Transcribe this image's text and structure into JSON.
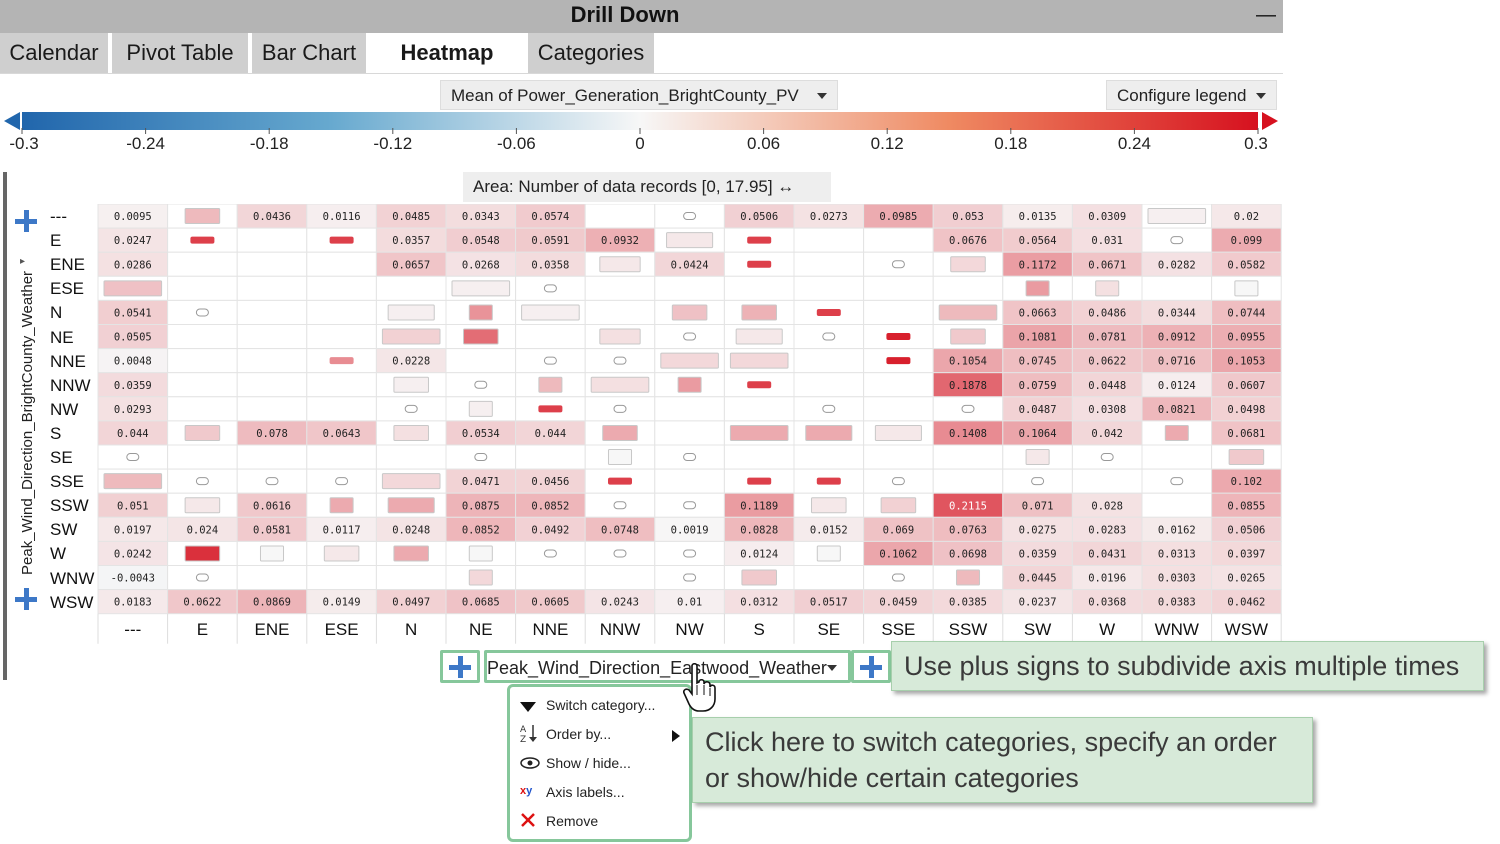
{
  "window": {
    "title": "Drill Down",
    "minimize_glyph": "—"
  },
  "tabs": [
    {
      "label": "Calendar",
      "active": false
    },
    {
      "label": "Pivot Table",
      "active": false
    },
    {
      "label": "Bar Chart",
      "active": false
    },
    {
      "label": "Heatmap",
      "active": true
    },
    {
      "label": "Categories",
      "active": false
    }
  ],
  "toolbar": {
    "measure_dropdown": "Mean of Power_Generation_BrightCounty_PV",
    "configure_legend": "Configure legend"
  },
  "legend": {
    "ticks": [
      "-0.3",
      "-0.24",
      "-0.18",
      "-0.12",
      "-0.06",
      "0",
      "0.06",
      "0.12",
      "0.18",
      "0.24",
      "0.3"
    ],
    "colors": {
      "negative": "#2166ac",
      "neutral": "#f7f7f7",
      "positive": "#d6111f"
    }
  },
  "area": {
    "label": "Area:",
    "value": "Number of data records  [0, 17.95] ↔"
  },
  "y_axis": {
    "title": "Peak_Wind_Direction_BrightCounty_Weather",
    "categories": [
      "---",
      "E",
      "ENE",
      "ESE",
      "N",
      "NE",
      "NNE",
      "NNW",
      "NW",
      "S",
      "SE",
      "SSE",
      "SSW",
      "SW",
      "W",
      "WNW",
      "WSW"
    ]
  },
  "x_axis": {
    "title": "Peak_Wind_Direction_Eastwood_Weather",
    "categories": [
      "---",
      "E",
      "ENE",
      "ESE",
      "N",
      "NE",
      "NNE",
      "NNW",
      "NW",
      "S",
      "SE",
      "SSE",
      "SSW",
      "SW",
      "W",
      "WNW",
      "WSW"
    ]
  },
  "chart_data": {
    "type": "heatmap",
    "color_range": [
      -0.3,
      0.3
    ],
    "rows": [
      {
        "label": "---",
        "values": [
          "0.0095",
          "",
          "0.0436",
          "0.0116",
          "0.0485",
          "0.0343",
          "0.0574",
          "",
          "",
          "0.0506",
          "0.0273",
          "0.0985",
          "0.053",
          "0.0135",
          "0.0309",
          "",
          "0.02"
        ]
      },
      {
        "label": "E",
        "values": [
          "0.0247",
          "",
          "",
          "",
          "0.0357",
          "0.0548",
          "0.0591",
          "0.0932",
          "",
          "",
          "",
          "",
          "0.0676",
          "0.0564",
          "0.031",
          "",
          "0.099"
        ]
      },
      {
        "label": "ENE",
        "values": [
          "0.0286",
          "",
          "",
          "",
          "0.0657",
          "0.0268",
          "0.0358",
          "",
          "0.0424",
          "",
          "",
          "",
          "",
          "0.1172",
          "0.0671",
          "0.0282",
          "0.0582"
        ]
      },
      {
        "label": "ESE",
        "values": [
          "",
          "",
          "",
          "",
          "",
          "",
          "",
          "",
          "",
          "",
          "",
          "",
          "",
          "",
          "",
          "",
          ""
        ]
      },
      {
        "label": "N",
        "values": [
          "0.0541",
          "",
          "",
          "",
          "",
          "",
          "",
          "",
          "",
          "",
          "",
          "",
          "",
          "0.0663",
          "0.0486",
          "0.0344",
          "0.0744"
        ]
      },
      {
        "label": "NE",
        "values": [
          "0.0505",
          "",
          "",
          "",
          "",
          "",
          "",
          "",
          "",
          "",
          "",
          "",
          "",
          "0.1081",
          "0.0781",
          "0.0912",
          "0.0955"
        ]
      },
      {
        "label": "NNE",
        "values": [
          "0.0048",
          "",
          "",
          "",
          "0.0228",
          "",
          "",
          "",
          "",
          "",
          "",
          "",
          "0.1054",
          "0.0745",
          "0.0622",
          "0.0716",
          "0.1053"
        ]
      },
      {
        "label": "NNW",
        "values": [
          "0.0359",
          "",
          "",
          "",
          "",
          "",
          "",
          "",
          "",
          "",
          "",
          "",
          "0.1878",
          "0.0759",
          "0.0448",
          "0.0124",
          "0.0607"
        ]
      },
      {
        "label": "NW",
        "values": [
          "0.0293",
          "",
          "",
          "",
          "",
          "",
          "",
          "",
          "",
          "",
          "",
          "",
          "",
          "0.0487",
          "0.0308",
          "0.0821",
          "0.0498"
        ]
      },
      {
        "label": "S",
        "values": [
          "0.044",
          "",
          "0.078",
          "0.0643",
          "",
          "0.0534",
          "0.044",
          "",
          "",
          "",
          "",
          "",
          "0.1408",
          "0.1064",
          "0.042",
          "",
          "0.0681"
        ]
      },
      {
        "label": "SE",
        "values": [
          "",
          "",
          "",
          "",
          "",
          "",
          "",
          "",
          "",
          "",
          "",
          "",
          "",
          "",
          "",
          "",
          ""
        ]
      },
      {
        "label": "SSE",
        "values": [
          "",
          "",
          "",
          "",
          "",
          "0.0471",
          "0.0456",
          "",
          "",
          "",
          "",
          "",
          "",
          "",
          "",
          "",
          "0.102"
        ]
      },
      {
        "label": "SSW",
        "values": [
          "0.051",
          "",
          "0.0616",
          "",
          "",
          "0.0875",
          "0.0852",
          "",
          "",
          "0.1189",
          "",
          "",
          "0.2115",
          "0.071",
          "0.028",
          "",
          "0.0855"
        ]
      },
      {
        "label": "SW",
        "values": [
          "0.0197",
          "0.024",
          "0.0581",
          "0.0117",
          "0.0248",
          "0.0852",
          "0.0492",
          "0.0748",
          "0.0019",
          "0.0828",
          "0.0152",
          "0.069",
          "0.0763",
          "0.0275",
          "0.0283",
          "0.0162",
          "0.0506"
        ]
      },
      {
        "label": "W",
        "values": [
          "0.0242",
          "",
          "",
          "",
          "",
          "",
          "",
          "",
          "",
          "0.0124",
          "",
          "0.1062",
          "0.0698",
          "0.0359",
          "0.0431",
          "0.0313",
          "0.0397"
        ]
      },
      {
        "label": "WNW",
        "values": [
          "-0.0043",
          "",
          "",
          "",
          "",
          "",
          "",
          "",
          "",
          "",
          "",
          "",
          "",
          "0.0445",
          "0.0196",
          "0.0303",
          "0.0265"
        ]
      },
      {
        "label": "WSW",
        "values": [
          "0.0183",
          "0.0622",
          "0.0869",
          "0.0149",
          "0.0497",
          "0.0685",
          "0.0605",
          "0.0243",
          "0.01",
          "0.0312",
          "0.0517",
          "0.0459",
          "0.0385",
          "0.0237",
          "0.0368",
          "0.0383",
          "0.0462"
        ]
      }
    ],
    "marks": [
      {
        "row": "---",
        "col": "E",
        "kind": "box",
        "value": 0.08,
        "fill": 0.6
      },
      {
        "row": "---",
        "col": "NW",
        "kind": "pill",
        "value": 0.0
      },
      {
        "row": "---",
        "col": "WNW",
        "kind": "box",
        "value": 0.01,
        "fill": 1.0
      },
      {
        "row": "E",
        "col": "E",
        "kind": "bar",
        "value": 0.24
      },
      {
        "row": "E",
        "col": "ESE",
        "kind": "bar",
        "value": 0.24
      },
      {
        "row": "E",
        "col": "NW",
        "kind": "box",
        "value": 0.02,
        "fill": 0.8
      },
      {
        "row": "E",
        "col": "S",
        "kind": "bar",
        "value": 0.24
      },
      {
        "row": "E",
        "col": "WNW",
        "kind": "pill",
        "value": 0.0
      },
      {
        "row": "ENE",
        "col": "NNW",
        "kind": "box",
        "value": 0.02,
        "fill": 0.7
      },
      {
        "row": "ENE",
        "col": "S",
        "kind": "bar",
        "value": 0.24
      },
      {
        "row": "ENE",
        "col": "SSE",
        "kind": "pill",
        "value": 0.0
      },
      {
        "row": "ENE",
        "col": "SSW",
        "kind": "box",
        "value": 0.04,
        "fill": 0.6
      },
      {
        "row": "ESE",
        "col": "---",
        "kind": "box",
        "value": 0.07,
        "fill": 1.0
      },
      {
        "row": "ESE",
        "col": "NE",
        "kind": "box",
        "value": 0.01,
        "fill": 1.0
      },
      {
        "row": "ESE",
        "col": "NNE",
        "kind": "pill",
        "value": 0.0
      },
      {
        "row": "ESE",
        "col": "SW",
        "kind": "box",
        "value": 0.12,
        "fill": 0.4
      },
      {
        "row": "ESE",
        "col": "W",
        "kind": "box",
        "value": 0.03,
        "fill": 0.4
      },
      {
        "row": "ESE",
        "col": "WSW",
        "kind": "box",
        "value": 0.0,
        "fill": 0.4
      },
      {
        "row": "N",
        "col": "E",
        "kind": "pill",
        "value": 0.0
      },
      {
        "row": "N",
        "col": "N",
        "kind": "box",
        "value": 0.01,
        "fill": 0.8
      },
      {
        "row": "N",
        "col": "NE",
        "kind": "box",
        "value": 0.13,
        "fill": 0.4
      },
      {
        "row": "N",
        "col": "NNE",
        "kind": "box",
        "value": 0.01,
        "fill": 1.0
      },
      {
        "row": "N",
        "col": "NW",
        "kind": "box",
        "value": 0.07,
        "fill": 0.6
      },
      {
        "row": "N",
        "col": "S",
        "kind": "box",
        "value": 0.09,
        "fill": 0.6
      },
      {
        "row": "N",
        "col": "SE",
        "kind": "bar",
        "value": 0.24
      },
      {
        "row": "N",
        "col": "SSW",
        "kind": "box",
        "value": 0.08,
        "fill": 1.0
      },
      {
        "row": "NE",
        "col": "N",
        "kind": "box",
        "value": 0.05,
        "fill": 1.0
      },
      {
        "row": "NE",
        "col": "NE",
        "kind": "box",
        "value": 0.18,
        "fill": 0.6
      },
      {
        "row": "NE",
        "col": "NNW",
        "kind": "box",
        "value": 0.03,
        "fill": 0.7
      },
      {
        "row": "NE",
        "col": "NW",
        "kind": "pill",
        "value": 0.0
      },
      {
        "row": "NE",
        "col": "S",
        "kind": "box",
        "value": 0.02,
        "fill": 0.8
      },
      {
        "row": "NE",
        "col": "SE",
        "kind": "pill",
        "value": 0.0
      },
      {
        "row": "NE",
        "col": "SSE",
        "kind": "bar",
        "value": 0.28
      },
      {
        "row": "NE",
        "col": "SSW",
        "kind": "box",
        "value": 0.06,
        "fill": 0.6
      },
      {
        "row": "NNE",
        "col": "ESE",
        "kind": "bar",
        "value": 0.14
      },
      {
        "row": "NNE",
        "col": "NNE",
        "kind": "pill",
        "value": 0.0
      },
      {
        "row": "NNE",
        "col": "NNW",
        "kind": "pill",
        "value": 0.0
      },
      {
        "row": "NNE",
        "col": "NW",
        "kind": "box",
        "value": 0.04,
        "fill": 1.0
      },
      {
        "row": "NNE",
        "col": "S",
        "kind": "box",
        "value": 0.04,
        "fill": 1.0
      },
      {
        "row": "NNE",
        "col": "SSE",
        "kind": "bar",
        "value": 0.28
      },
      {
        "row": "NNW",
        "col": "N",
        "kind": "box",
        "value": 0.01,
        "fill": 0.6
      },
      {
        "row": "NNW",
        "col": "NE",
        "kind": "pill",
        "value": 0.0
      },
      {
        "row": "NNW",
        "col": "NNE",
        "kind": "box",
        "value": 0.08,
        "fill": 0.4
      },
      {
        "row": "NNW",
        "col": "NNW",
        "kind": "box",
        "value": 0.03,
        "fill": 1.0
      },
      {
        "row": "NNW",
        "col": "NW",
        "kind": "box",
        "value": 0.12,
        "fill": 0.4
      },
      {
        "row": "NNW",
        "col": "S",
        "kind": "bar",
        "value": 0.24
      },
      {
        "row": "NW",
        "col": "N",
        "kind": "pill",
        "value": 0.0
      },
      {
        "row": "NW",
        "col": "NE",
        "kind": "box",
        "value": 0.01,
        "fill": 0.4
      },
      {
        "row": "NW",
        "col": "NNE",
        "kind": "bar",
        "value": 0.24
      },
      {
        "row": "NW",
        "col": "NNW",
        "kind": "pill",
        "value": 0.0
      },
      {
        "row": "NW",
        "col": "SE",
        "kind": "pill",
        "value": 0.0
      },
      {
        "row": "NW",
        "col": "SSW",
        "kind": "pill",
        "value": 0.0
      },
      {
        "row": "S",
        "col": "E",
        "kind": "box",
        "value": 0.06,
        "fill": 0.6
      },
      {
        "row": "S",
        "col": "N",
        "kind": "box",
        "value": 0.03,
        "fill": 0.6
      },
      {
        "row": "S",
        "col": "NNW",
        "kind": "box",
        "value": 0.1,
        "fill": 0.6
      },
      {
        "row": "S",
        "col": "S",
        "kind": "box",
        "value": 0.1,
        "fill": 1.0
      },
      {
        "row": "S",
        "col": "SE",
        "kind": "box",
        "value": 0.1,
        "fill": 0.8
      },
      {
        "row": "S",
        "col": "SSE",
        "kind": "box",
        "value": 0.02,
        "fill": 0.8
      },
      {
        "row": "S",
        "col": "WNW",
        "kind": "box",
        "value": 0.1,
        "fill": 0.4
      },
      {
        "row": "SE",
        "col": "---",
        "kind": "pill",
        "value": 0.0
      },
      {
        "row": "SE",
        "col": "NE",
        "kind": "pill",
        "value": 0.0
      },
      {
        "row": "SE",
        "col": "NNW",
        "kind": "box",
        "value": 0.0,
        "fill": 0.4
      },
      {
        "row": "SE",
        "col": "NW",
        "kind": "pill",
        "value": 0.0
      },
      {
        "row": "SE",
        "col": "SW",
        "kind": "box",
        "value": 0.02,
        "fill": 0.4
      },
      {
        "row": "SE",
        "col": "W",
        "kind": "pill",
        "value": 0.0
      },
      {
        "row": "SE",
        "col": "WSW",
        "kind": "box",
        "value": 0.06,
        "fill": 0.6
      },
      {
        "row": "SSE",
        "col": "---",
        "kind": "box",
        "value": 0.08,
        "fill": 1.0
      },
      {
        "row": "SSE",
        "col": "E",
        "kind": "pill",
        "value": 0.0
      },
      {
        "row": "SSE",
        "col": "ENE",
        "kind": "pill",
        "value": 0.0
      },
      {
        "row": "SSE",
        "col": "ESE",
        "kind": "pill",
        "value": 0.0
      },
      {
        "row": "SSE",
        "col": "N",
        "kind": "box",
        "value": 0.04,
        "fill": 1.0
      },
      {
        "row": "SSE",
        "col": "NNW",
        "kind": "bar",
        "value": 0.24
      },
      {
        "row": "SSE",
        "col": "S",
        "kind": "bar",
        "value": 0.24
      },
      {
        "row": "SSE",
        "col": "SE",
        "kind": "bar",
        "value": 0.24
      },
      {
        "row": "SSE",
        "col": "SSE",
        "kind": "pill",
        "value": 0.0
      },
      {
        "row": "SSE",
        "col": "SW",
        "kind": "pill",
        "value": 0.0
      },
      {
        "row": "SSE",
        "col": "WNW",
        "kind": "pill",
        "value": 0.0
      },
      {
        "row": "SSW",
        "col": "E",
        "kind": "box",
        "value": 0.02,
        "fill": 0.6
      },
      {
        "row": "SSW",
        "col": "ESE",
        "kind": "box",
        "value": 0.1,
        "fill": 0.4
      },
      {
        "row": "SSW",
        "col": "N",
        "kind": "box",
        "value": 0.1,
        "fill": 0.8
      },
      {
        "row": "SSW",
        "col": "NNW",
        "kind": "pill",
        "value": 0.0
      },
      {
        "row": "SSW",
        "col": "NW",
        "kind": "pill",
        "value": 0.0
      },
      {
        "row": "SSW",
        "col": "SE",
        "kind": "box",
        "value": 0.02,
        "fill": 0.6
      },
      {
        "row": "SSW",
        "col": "SSE",
        "kind": "box",
        "value": 0.05,
        "fill": 0.6
      },
      {
        "row": "W",
        "col": "E",
        "kind": "box",
        "value": 0.26,
        "fill": 0.6
      },
      {
        "row": "W",
        "col": "ENE",
        "kind": "box",
        "value": 0.0,
        "fill": 0.4
      },
      {
        "row": "W",
        "col": "ESE",
        "kind": "box",
        "value": 0.02,
        "fill": 0.6
      },
      {
        "row": "W",
        "col": "N",
        "kind": "box",
        "value": 0.1,
        "fill": 0.6
      },
      {
        "row": "W",
        "col": "NE",
        "kind": "box",
        "value": 0.0,
        "fill": 0.4
      },
      {
        "row": "W",
        "col": "NNE",
        "kind": "pill",
        "value": 0.0
      },
      {
        "row": "W",
        "col": "NNW",
        "kind": "pill",
        "value": 0.0
      },
      {
        "row": "W",
        "col": "NW",
        "kind": "pill",
        "value": 0.0
      },
      {
        "row": "W",
        "col": "SE",
        "kind": "box",
        "value": 0.0,
        "fill": 0.4
      },
      {
        "row": "WNW",
        "col": "E",
        "kind": "pill",
        "value": 0.0
      },
      {
        "row": "WNW",
        "col": "NE",
        "kind": "box",
        "value": 0.04,
        "fill": 0.4
      },
      {
        "row": "WNW",
        "col": "NW",
        "kind": "pill",
        "value": 0.0
      },
      {
        "row": "WNW",
        "col": "S",
        "kind": "box",
        "value": 0.06,
        "fill": 0.6
      },
      {
        "row": "WNW",
        "col": "SSE",
        "kind": "pill",
        "value": 0.0
      },
      {
        "row": "WNW",
        "col": "SSW",
        "kind": "box",
        "value": 0.08,
        "fill": 0.4
      }
    ]
  },
  "context_menu": {
    "items": [
      {
        "label": "Switch category...",
        "icon": "triangle-down-icon"
      },
      {
        "label": "Order by...",
        "icon": "sort-icon",
        "submenu_arrow": true
      },
      {
        "label": "Show / hide...",
        "icon": "eye-icon"
      },
      {
        "label": "Axis labels...",
        "icon": "xy-icon"
      },
      {
        "label": "Remove",
        "icon": "x-icon"
      }
    ]
  },
  "callouts": {
    "plus_note": "Use plus signs to subdivide axis multiple times",
    "menu_note_line1": "Click here to switch categories, specify an order",
    "menu_note_line2": "or show/hide certain categories"
  }
}
